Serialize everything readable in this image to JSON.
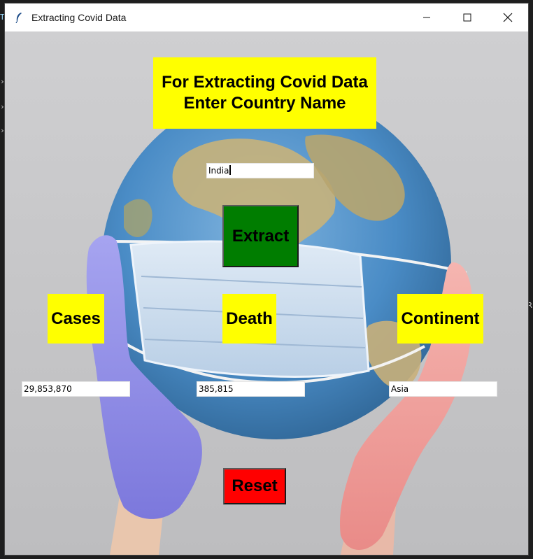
{
  "window": {
    "title": "Extracting Covid Data",
    "controls": {
      "minimize": "minimize-icon",
      "maximize": "maximize-icon",
      "close": "close-icon"
    }
  },
  "heading": {
    "line1": "For Extracting Covid Data",
    "line2": "Enter Country Name"
  },
  "country_input": {
    "value": "India"
  },
  "extract_button": {
    "label": "Extract",
    "color": "#007d00"
  },
  "labels": {
    "cases": "Cases",
    "death": "Death",
    "continent": "Continent"
  },
  "results": {
    "cases": "29,853,870",
    "death": "385,815",
    "continent": "Asia"
  },
  "reset_button": {
    "label": "Reset",
    "color": "#ff0000"
  },
  "colors": {
    "label_bg": "#ffff00",
    "globe_ocean": "#4a8cc6",
    "glove_left": "#8f8ce8",
    "glove_right": "#f2a3a3"
  }
}
